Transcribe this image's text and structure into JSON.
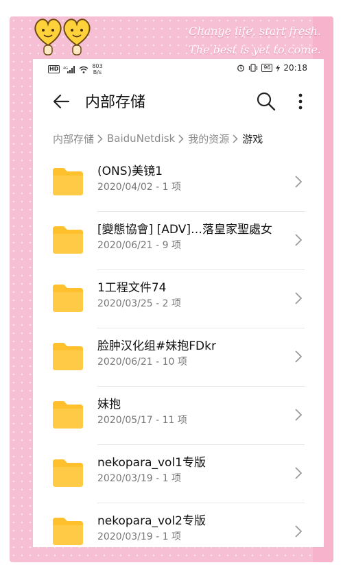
{
  "decoration": {
    "line1": "Change life, start fresh.",
    "line2": "The best is yet to come."
  },
  "status_bar": {
    "network_speed_value": "803",
    "network_speed_unit": "B/s",
    "battery": "96",
    "time": "20:18"
  },
  "app_bar": {
    "title": "内部存储"
  },
  "breadcrumb": {
    "items": [
      "内部存储",
      "BaiduNetdisk",
      "我的资源"
    ],
    "current": "游戏"
  },
  "files": [
    {
      "name": "(ONS)美镜1",
      "meta": "2020/04/02 - 1 项"
    },
    {
      "name": "[變態協會] [ADV]…落皇家聖處女",
      "meta": "2020/06/21 - 9 项"
    },
    {
      "name": "1工程文件74",
      "meta": "2020/03/25 - 2 项"
    },
    {
      "name": "脸肿汉化组#妹抱FDkr",
      "meta": "2020/06/21 - 10 项"
    },
    {
      "name": "妹抱",
      "meta": "2020/05/17 - 11 项"
    },
    {
      "name": "nekopara_vol1专版",
      "meta": "2020/03/19 - 1 项"
    },
    {
      "name": "nekopara_vol2专版",
      "meta": "2020/03/19 - 1 项"
    }
  ],
  "colors": {
    "frame_pink": "#f7bfd3",
    "folder_yellow": "#ffc02e"
  }
}
